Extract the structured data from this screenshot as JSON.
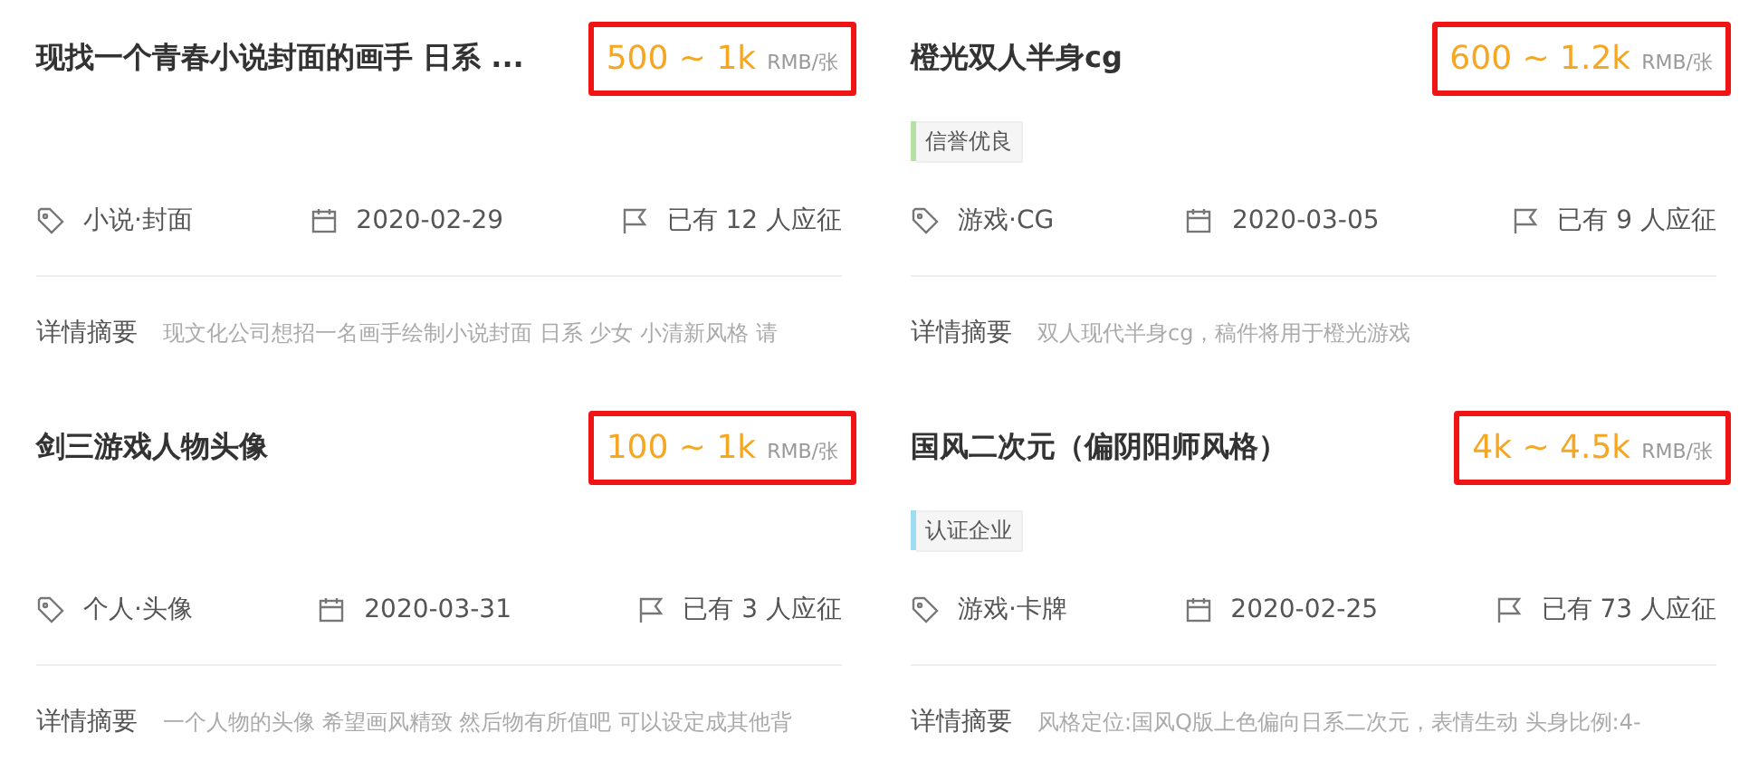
{
  "cards": [
    {
      "title": "现找一个青春小说封面的画手 日系 ...",
      "price": {
        "range": "500 ~ 1k",
        "unit": "RMB/张",
        "highlighted": true
      },
      "category": "小说·封面",
      "date": "2020-02-29",
      "applicants": "已有 12 人应征",
      "summary_label": "详情摘要",
      "summary": "现文化公司想招一名画手绘制小说封面 日系 少女 小清新风格 请"
    },
    {
      "title": "橙光双人半身cg",
      "price": {
        "range": "600 ~ 1.2k",
        "unit": "RMB/张",
        "highlighted": true
      },
      "badge": {
        "label": "信誉优良",
        "color": "#b5e2a4"
      },
      "category": "游戏·CG",
      "date": "2020-03-05",
      "applicants": "已有 9 人应征",
      "summary_label": "详情摘要",
      "summary": "双人现代半身cg，稿件将用于橙光游戏"
    },
    {
      "title": "剑三游戏人物头像",
      "price": {
        "range": "100 ~ 1k",
        "unit": "RMB/张",
        "highlighted": true
      },
      "category": "个人·头像",
      "date": "2020-03-31",
      "applicants": "已有 3 人应征",
      "summary_label": "详情摘要",
      "summary": "一个人物的头像 希望画风精致 然后物有所值吧 可以设定成其他背"
    },
    {
      "title": "国风二次元（偏阴阳师风格）",
      "price": {
        "range": "4k ~ 4.5k",
        "unit": "RMB/张",
        "highlighted": true
      },
      "badge": {
        "label": "认证企业",
        "color": "#9fdcf3"
      },
      "category": "游戏·卡牌",
      "date": "2020-02-25",
      "applicants": "已有 73 人应征",
      "summary_label": "详情摘要",
      "summary": "风格定位:国风Q版上色偏向日系二次元，表情生动 头身比例:4-"
    }
  ]
}
